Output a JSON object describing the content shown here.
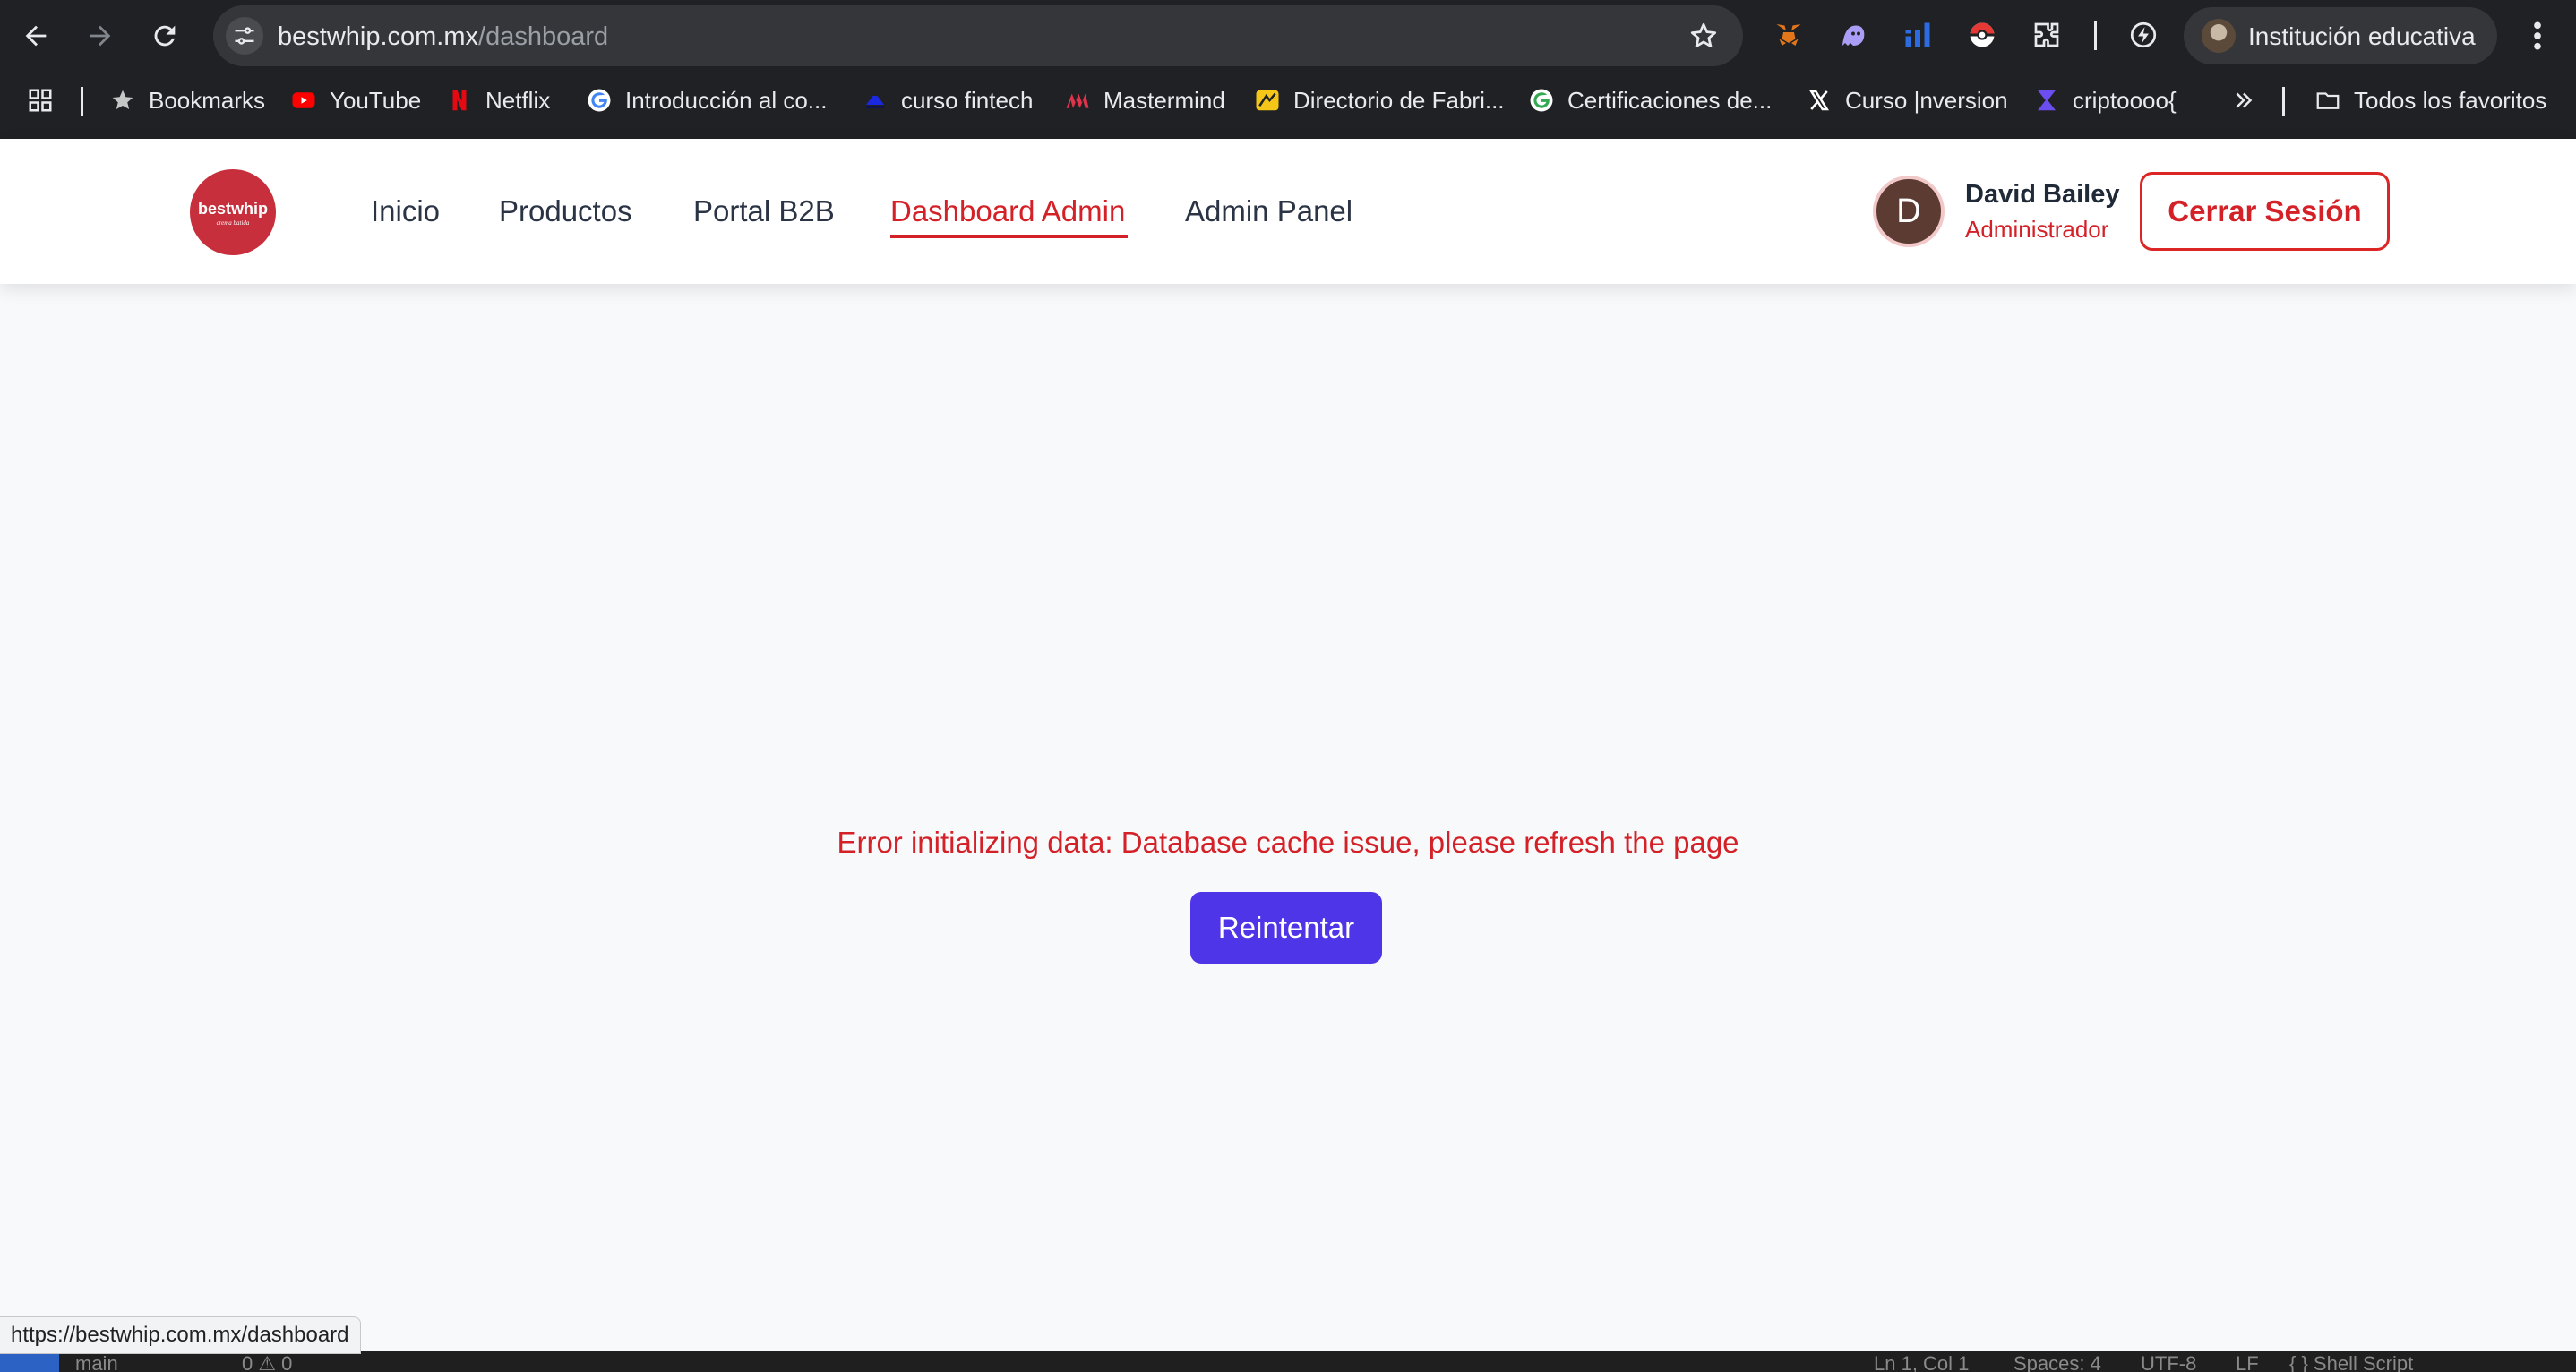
{
  "browser": {
    "url_host": "bestwhip.com.mx",
    "url_path": "/dashboard",
    "profile_label": "Institución educativa",
    "bookmarks": [
      {
        "label": "Bookmarks",
        "icon": "star-icon"
      },
      {
        "label": "YouTube",
        "icon": "youtube-icon"
      },
      {
        "label": "Netflix",
        "icon": "netflix-icon"
      },
      {
        "label": "Introducción al co...",
        "icon": "google-icon"
      },
      {
        "label": "curso fintech",
        "icon": "platzi-icon"
      },
      {
        "label": "Mastermind",
        "icon": "mastermind-icon"
      },
      {
        "label": "Directorio de Fabri...",
        "icon": "directory-icon"
      },
      {
        "label": "Certificaciones de...",
        "icon": "google-icon"
      },
      {
        "label": "Curso |nversion",
        "icon": "x-icon"
      },
      {
        "label": "criptoooo{",
        "icon": "kraken-icon"
      }
    ],
    "all_bookmarks_label": "Todos los favoritos",
    "status_url": "https://bestwhip.com.mx/dashboard"
  },
  "site": {
    "logo_alt": "bestwhip",
    "nav": [
      {
        "label": "Inicio",
        "active": false
      },
      {
        "label": "Productos",
        "active": false
      },
      {
        "label": "Portal B2B",
        "active": false
      },
      {
        "label": "Dashboard Admin",
        "active": true
      },
      {
        "label": "Admin Panel",
        "active": false
      }
    ],
    "user": {
      "initial": "D",
      "name": "David Bailey",
      "role": "Administrador"
    },
    "logout_label": "Cerrar Sesión"
  },
  "main": {
    "error_message": "Error initializing data: Database cache issue, please refresh the page",
    "retry_label": "Reintentar"
  },
  "editor_status": {
    "branch": "main",
    "problems": "0 ⚠ 0",
    "position": "Ln 1, Col 1",
    "spaces": "Spaces: 4",
    "encoding": "UTF-8",
    "eol": "LF",
    "language": "{ } Shell Script"
  },
  "colors": {
    "accent_red": "#d42027",
    "primary_button": "#4f35e8",
    "logo_red": "#c62f3b",
    "chrome_bg": "#202124"
  }
}
